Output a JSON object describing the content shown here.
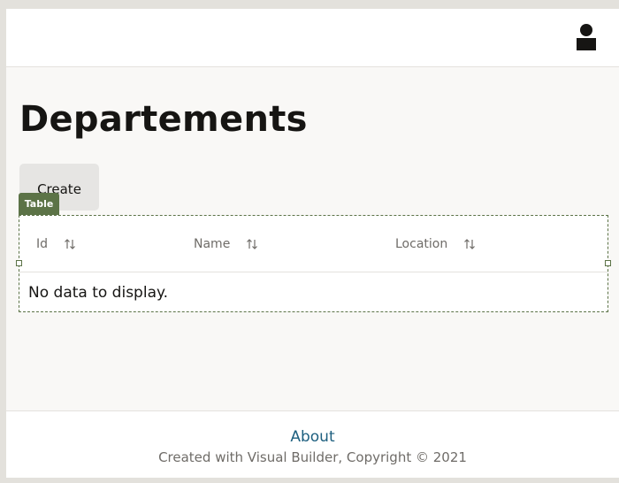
{
  "header": {
    "user_icon": "user-avatar-icon"
  },
  "main": {
    "title": "Departements",
    "create_label": "Create",
    "table_tag": "Table",
    "columns": [
      {
        "label": "Id",
        "icon": "sort-icon"
      },
      {
        "label": "Name",
        "icon": "sort-icon"
      },
      {
        "label": "Location",
        "icon": "sort-icon"
      }
    ],
    "empty_message": "No data to display."
  },
  "footer": {
    "about_label": "About",
    "copyright": "Created with Visual Builder, Copyright © 2021"
  },
  "colors": {
    "accent": "#5c7347",
    "link": "#1d5f7f",
    "page_bg": "#f9f8f6"
  }
}
